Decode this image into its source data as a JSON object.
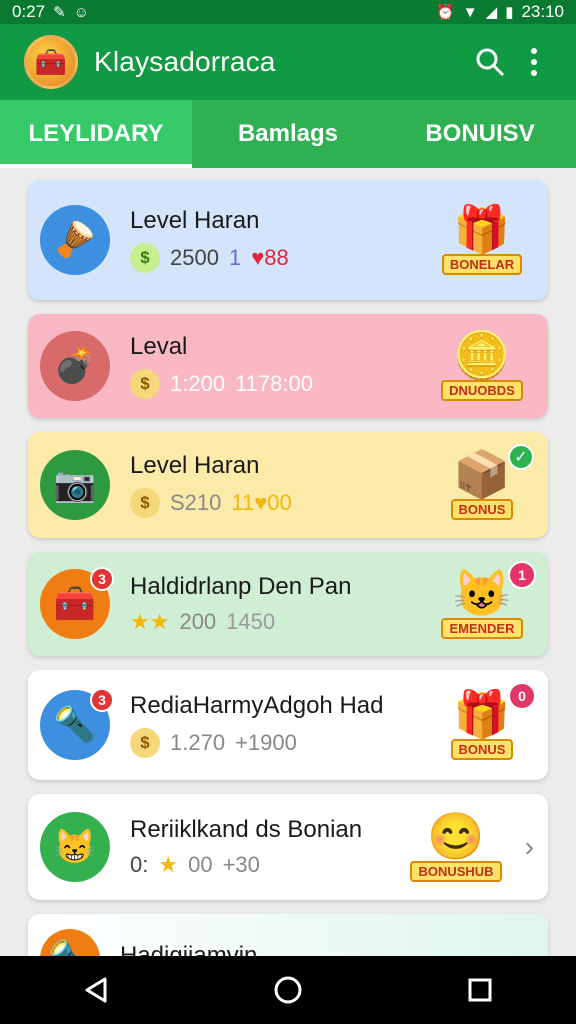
{
  "status": {
    "time": "0:27",
    "clock": "23:10"
  },
  "app": {
    "title": "Klaysadorraca"
  },
  "tabs": [
    {
      "label": "LEYLIDARY",
      "active": true
    },
    {
      "label": "Bamlags",
      "active": false
    },
    {
      "label": "BONUISV",
      "active": false
    }
  ],
  "cards": [
    {
      "title": "Level Haran",
      "stat1": "2500",
      "stat2": "1",
      "stat2_extra": "♥88",
      "reward_label": "BONELAR",
      "avatar": "cannon-gold-icon"
    },
    {
      "title": "Leval",
      "stat1": "1:200",
      "stat2": "1178:00",
      "reward_label": "DNUOBDS",
      "avatar": "cannon-icon"
    },
    {
      "title": "Level Haran",
      "stat1": "S210",
      "stat2": "11♥00",
      "reward_label": "BONUS",
      "avatar": "camera-icon"
    },
    {
      "title": "Haldidrlanp Den Pan",
      "stat1": "200",
      "stat2": "1450",
      "reward_label": "EMENDER",
      "avatar": "chest-icon",
      "badge": "3",
      "reward_badge": "1"
    },
    {
      "title": "RediaHarmyAdgoh Had",
      "stat1": "1.270",
      "stat2": "+1900",
      "reward_label": "BONUS",
      "avatar": "torch-icon",
      "badge": "3",
      "reward_badge": "0"
    },
    {
      "title": "Reriiklkand ds Bonian",
      "stat1": "0:",
      "stat1_extra": "00",
      "stat2": "+30",
      "reward_label": "BONUSHUB",
      "avatar": "smiley-icon"
    },
    {
      "title": "Hadigiiamvin"
    }
  ],
  "colors": {
    "primary": "#0f9a43",
    "accent": "#36c96a",
    "status": "#0a7a32"
  }
}
